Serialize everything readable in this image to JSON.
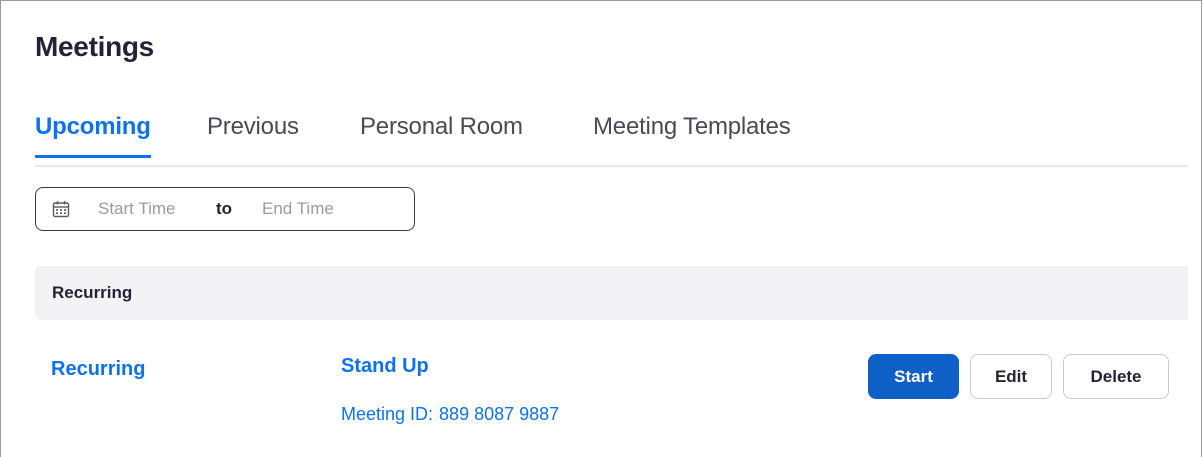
{
  "page": {
    "title": "Meetings"
  },
  "tabs": [
    {
      "label": "Upcoming",
      "active": true
    },
    {
      "label": "Previous",
      "active": false
    },
    {
      "label": "Personal Room",
      "active": false
    },
    {
      "label": "Meeting Templates",
      "active": false
    }
  ],
  "date_filter": {
    "icon": "calendar-icon",
    "start_placeholder": "Start Time",
    "start_value": "",
    "separator": "to",
    "end_placeholder": "End Time",
    "end_value": ""
  },
  "section": {
    "title": "Recurring"
  },
  "meetings": [
    {
      "type_label": "Recurring",
      "topic": "Stand Up",
      "id_label": "Meeting ID:",
      "id_value": "889 8087 9887",
      "actions": {
        "start": "Start",
        "edit": "Edit",
        "delete": "Delete"
      }
    }
  ],
  "colors": {
    "accent": "#0e72ed",
    "primary_button": "#0e5fc6",
    "section_bg": "#f3f3f6",
    "text": "#232333"
  }
}
